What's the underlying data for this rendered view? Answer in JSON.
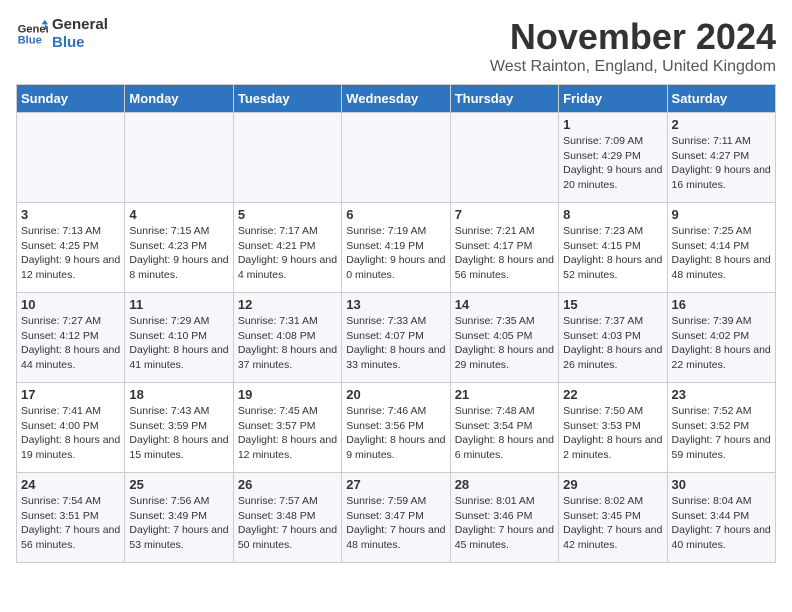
{
  "logo": {
    "line1": "General",
    "line2": "Blue"
  },
  "title": "November 2024",
  "subtitle": "West Rainton, England, United Kingdom",
  "headers": [
    "Sunday",
    "Monday",
    "Tuesday",
    "Wednesday",
    "Thursday",
    "Friday",
    "Saturday"
  ],
  "weeks": [
    [
      {
        "day": "",
        "info": ""
      },
      {
        "day": "",
        "info": ""
      },
      {
        "day": "",
        "info": ""
      },
      {
        "day": "",
        "info": ""
      },
      {
        "day": "",
        "info": ""
      },
      {
        "day": "1",
        "info": "Sunrise: 7:09 AM\nSunset: 4:29 PM\nDaylight: 9 hours and 20 minutes."
      },
      {
        "day": "2",
        "info": "Sunrise: 7:11 AM\nSunset: 4:27 PM\nDaylight: 9 hours and 16 minutes."
      }
    ],
    [
      {
        "day": "3",
        "info": "Sunrise: 7:13 AM\nSunset: 4:25 PM\nDaylight: 9 hours and 12 minutes."
      },
      {
        "day": "4",
        "info": "Sunrise: 7:15 AM\nSunset: 4:23 PM\nDaylight: 9 hours and 8 minutes."
      },
      {
        "day": "5",
        "info": "Sunrise: 7:17 AM\nSunset: 4:21 PM\nDaylight: 9 hours and 4 minutes."
      },
      {
        "day": "6",
        "info": "Sunrise: 7:19 AM\nSunset: 4:19 PM\nDaylight: 9 hours and 0 minutes."
      },
      {
        "day": "7",
        "info": "Sunrise: 7:21 AM\nSunset: 4:17 PM\nDaylight: 8 hours and 56 minutes."
      },
      {
        "day": "8",
        "info": "Sunrise: 7:23 AM\nSunset: 4:15 PM\nDaylight: 8 hours and 52 minutes."
      },
      {
        "day": "9",
        "info": "Sunrise: 7:25 AM\nSunset: 4:14 PM\nDaylight: 8 hours and 48 minutes."
      }
    ],
    [
      {
        "day": "10",
        "info": "Sunrise: 7:27 AM\nSunset: 4:12 PM\nDaylight: 8 hours and 44 minutes."
      },
      {
        "day": "11",
        "info": "Sunrise: 7:29 AM\nSunset: 4:10 PM\nDaylight: 8 hours and 41 minutes."
      },
      {
        "day": "12",
        "info": "Sunrise: 7:31 AM\nSunset: 4:08 PM\nDaylight: 8 hours and 37 minutes."
      },
      {
        "day": "13",
        "info": "Sunrise: 7:33 AM\nSunset: 4:07 PM\nDaylight: 8 hours and 33 minutes."
      },
      {
        "day": "14",
        "info": "Sunrise: 7:35 AM\nSunset: 4:05 PM\nDaylight: 8 hours and 29 minutes."
      },
      {
        "day": "15",
        "info": "Sunrise: 7:37 AM\nSunset: 4:03 PM\nDaylight: 8 hours and 26 minutes."
      },
      {
        "day": "16",
        "info": "Sunrise: 7:39 AM\nSunset: 4:02 PM\nDaylight: 8 hours and 22 minutes."
      }
    ],
    [
      {
        "day": "17",
        "info": "Sunrise: 7:41 AM\nSunset: 4:00 PM\nDaylight: 8 hours and 19 minutes."
      },
      {
        "day": "18",
        "info": "Sunrise: 7:43 AM\nSunset: 3:59 PM\nDaylight: 8 hours and 15 minutes."
      },
      {
        "day": "19",
        "info": "Sunrise: 7:45 AM\nSunset: 3:57 PM\nDaylight: 8 hours and 12 minutes."
      },
      {
        "day": "20",
        "info": "Sunrise: 7:46 AM\nSunset: 3:56 PM\nDaylight: 8 hours and 9 minutes."
      },
      {
        "day": "21",
        "info": "Sunrise: 7:48 AM\nSunset: 3:54 PM\nDaylight: 8 hours and 6 minutes."
      },
      {
        "day": "22",
        "info": "Sunrise: 7:50 AM\nSunset: 3:53 PM\nDaylight: 8 hours and 2 minutes."
      },
      {
        "day": "23",
        "info": "Sunrise: 7:52 AM\nSunset: 3:52 PM\nDaylight: 7 hours and 59 minutes."
      }
    ],
    [
      {
        "day": "24",
        "info": "Sunrise: 7:54 AM\nSunset: 3:51 PM\nDaylight: 7 hours and 56 minutes."
      },
      {
        "day": "25",
        "info": "Sunrise: 7:56 AM\nSunset: 3:49 PM\nDaylight: 7 hours and 53 minutes."
      },
      {
        "day": "26",
        "info": "Sunrise: 7:57 AM\nSunset: 3:48 PM\nDaylight: 7 hours and 50 minutes."
      },
      {
        "day": "27",
        "info": "Sunrise: 7:59 AM\nSunset: 3:47 PM\nDaylight: 7 hours and 48 minutes."
      },
      {
        "day": "28",
        "info": "Sunrise: 8:01 AM\nSunset: 3:46 PM\nDaylight: 7 hours and 45 minutes."
      },
      {
        "day": "29",
        "info": "Sunrise: 8:02 AM\nSunset: 3:45 PM\nDaylight: 7 hours and 42 minutes."
      },
      {
        "day": "30",
        "info": "Sunrise: 8:04 AM\nSunset: 3:44 PM\nDaylight: 7 hours and 40 minutes."
      }
    ]
  ]
}
